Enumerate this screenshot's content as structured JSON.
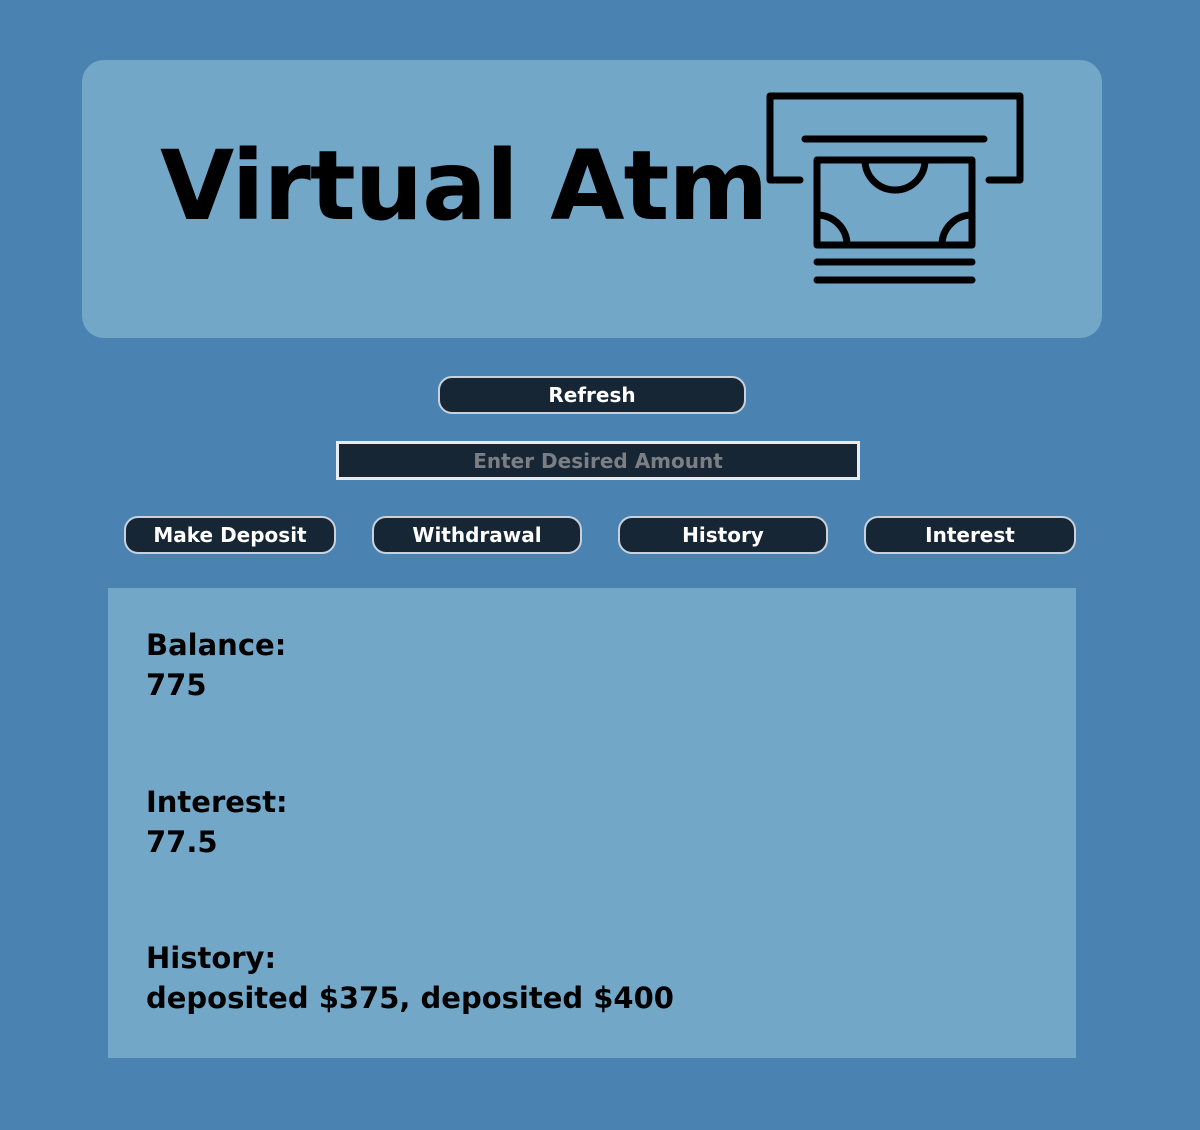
{
  "header": {
    "title": "Virtual Atm",
    "icon": "atm-cash-icon"
  },
  "controls": {
    "refresh_label": "Refresh",
    "amount_placeholder": "Enter Desired Amount",
    "amount_value": "",
    "deposit_label": "Make Deposit",
    "withdrawal_label": "Withdrawal",
    "history_label": "History",
    "interest_label": "Interest"
  },
  "account": {
    "balance_label": "Balance:",
    "balance_value": "775",
    "interest_label": "Interest:",
    "interest_value": "77.5",
    "history_label": "History:",
    "history_value": "deposited $375, deposited $400"
  },
  "colors": {
    "background": "#4a82b1",
    "panel": "#72a7c8",
    "button": "#172635",
    "button_text": "#ffffff",
    "text": "#000000"
  }
}
